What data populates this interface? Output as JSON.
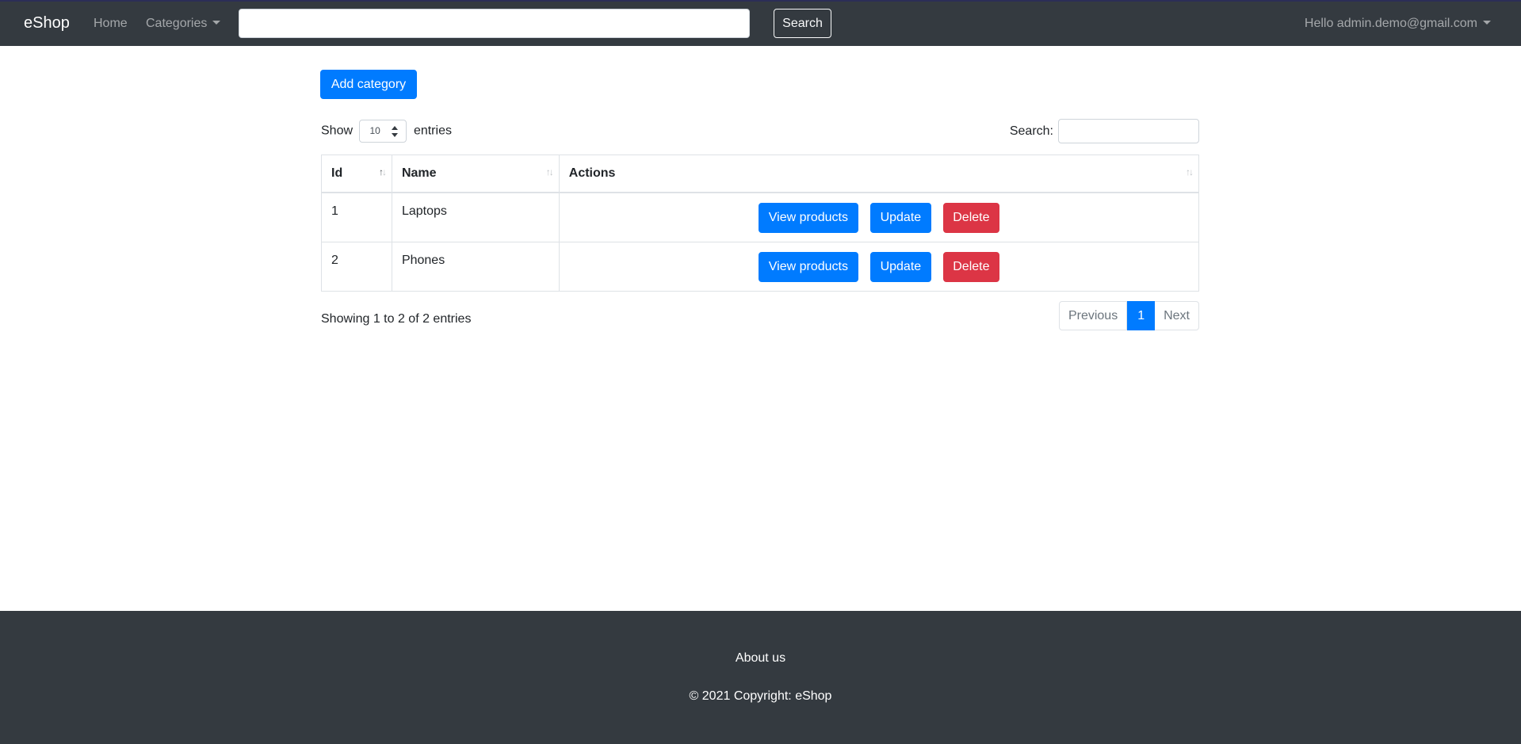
{
  "navbar": {
    "brand": "eShop",
    "home": "Home",
    "categories": "Categories",
    "search_value": "",
    "search_button": "Search",
    "user": "Hello admin.demo@gmail.com"
  },
  "main": {
    "add_button": "Add category",
    "length": {
      "show": "Show",
      "value": "10",
      "entries": "entries"
    },
    "filter": {
      "label": "Search:"
    },
    "table": {
      "headers": [
        "Id",
        "Name",
        "Actions"
      ],
      "rows": [
        {
          "id": "1",
          "name": "Laptops",
          "view": "View products",
          "update": "Update",
          "delete": "Delete"
        },
        {
          "id": "2",
          "name": "Phones",
          "view": "View products",
          "update": "Update",
          "delete": "Delete"
        }
      ]
    },
    "info": "Showing 1 to 2 of 2 entries",
    "pagination": {
      "previous": "Previous",
      "current": "1",
      "next": "Next"
    }
  },
  "footer": {
    "about": "About us",
    "copyright": "© 2021 Copyright: eShop"
  },
  "colors": {
    "navbar_bg": "#343a40",
    "primary": "#007bff",
    "danger": "#dc3545"
  }
}
